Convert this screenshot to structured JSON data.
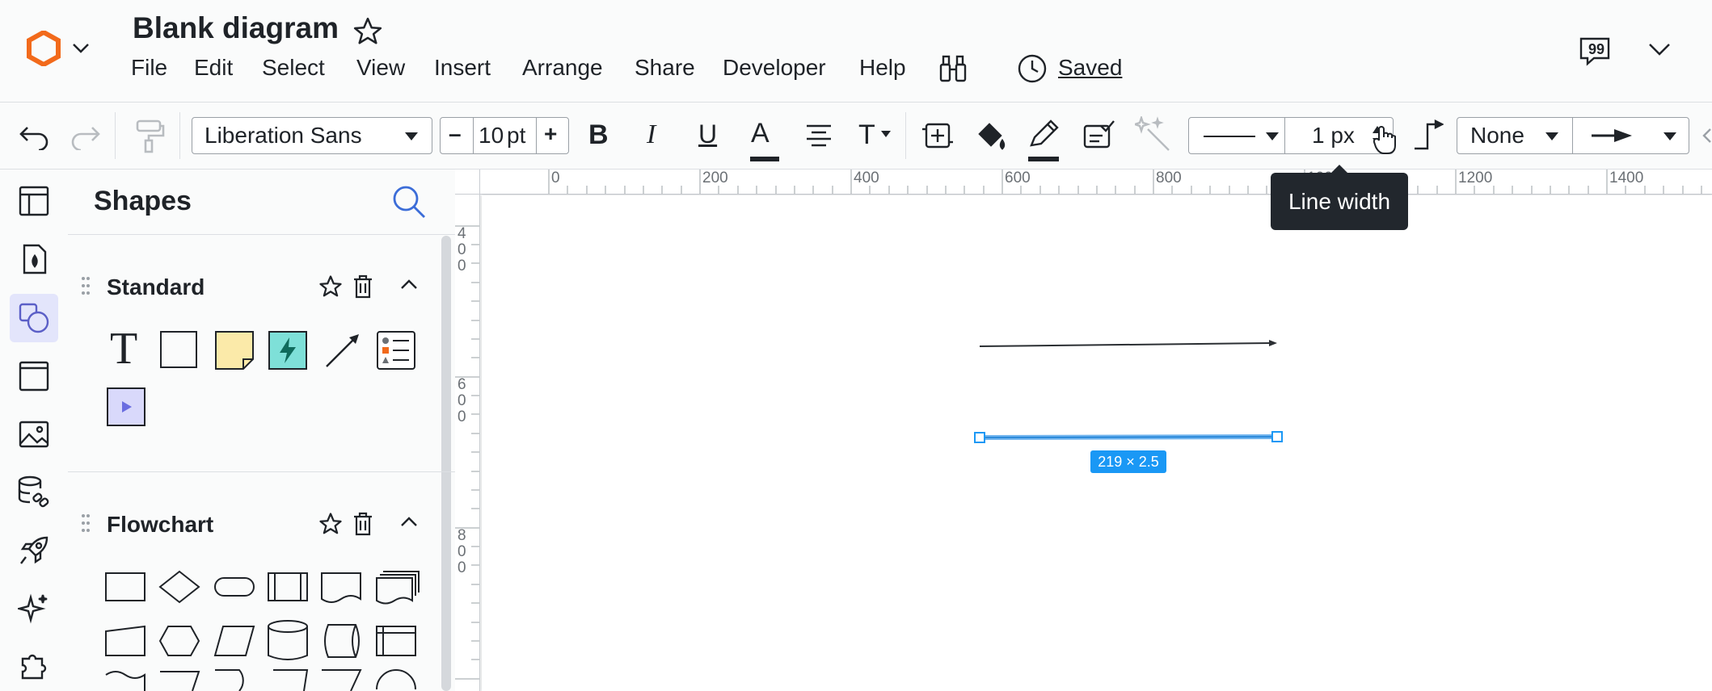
{
  "header": {
    "title": "Blank diagram",
    "menu": [
      "File",
      "Edit",
      "Select",
      "View",
      "Insert",
      "Arrange",
      "Share",
      "Developer",
      "Help"
    ],
    "saved_label": "Saved"
  },
  "toolbar": {
    "font_family": "Liberation Sans",
    "font_size": "10",
    "font_size_unit": "pt",
    "minus_label": "–",
    "plus_label": "+",
    "bold_label": "B",
    "italic_label": "I",
    "underline_label": "U",
    "text_color_label": "A",
    "text_options_label": "T",
    "line_width_value": "1 px",
    "line_start_value": "None",
    "tooltip": "Line width"
  },
  "shapes_panel": {
    "title": "Shapes",
    "sections": [
      {
        "name": "Standard"
      },
      {
        "name": "Flowchart"
      }
    ],
    "text_shape_glyph": "T"
  },
  "ruler": {
    "top_labels": [
      "0",
      "200",
      "400",
      "600",
      "800",
      "1000",
      "1200",
      "1400"
    ],
    "left_labels": [
      "400",
      "600",
      "800"
    ]
  },
  "canvas": {
    "selection_dimensions": "219 × 2.5"
  },
  "colors": {
    "accent": "#1a98f5",
    "brand_orange": "#f26a1b",
    "sticky_note": "#fbeaa9",
    "action_teal": "#7ee0d8",
    "rail_active_bg": "#e3e5fb",
    "tooltip_bg": "#22272d"
  },
  "icons": [
    "lucid-logo-icon",
    "chevron-down-icon",
    "star-icon",
    "binoculars-icon",
    "clock-icon",
    "comment-icon",
    "undo-icon",
    "redo-icon",
    "format-painter-icon",
    "align-center-icon",
    "crop-icon",
    "fill-bucket-icon",
    "pencil-icon",
    "stamp-icon",
    "magic-wand-icon",
    "connector-icon",
    "arrow-end-icon",
    "search-icon",
    "trash-icon",
    "chevron-up-icon",
    "drag-handle-icon"
  ]
}
